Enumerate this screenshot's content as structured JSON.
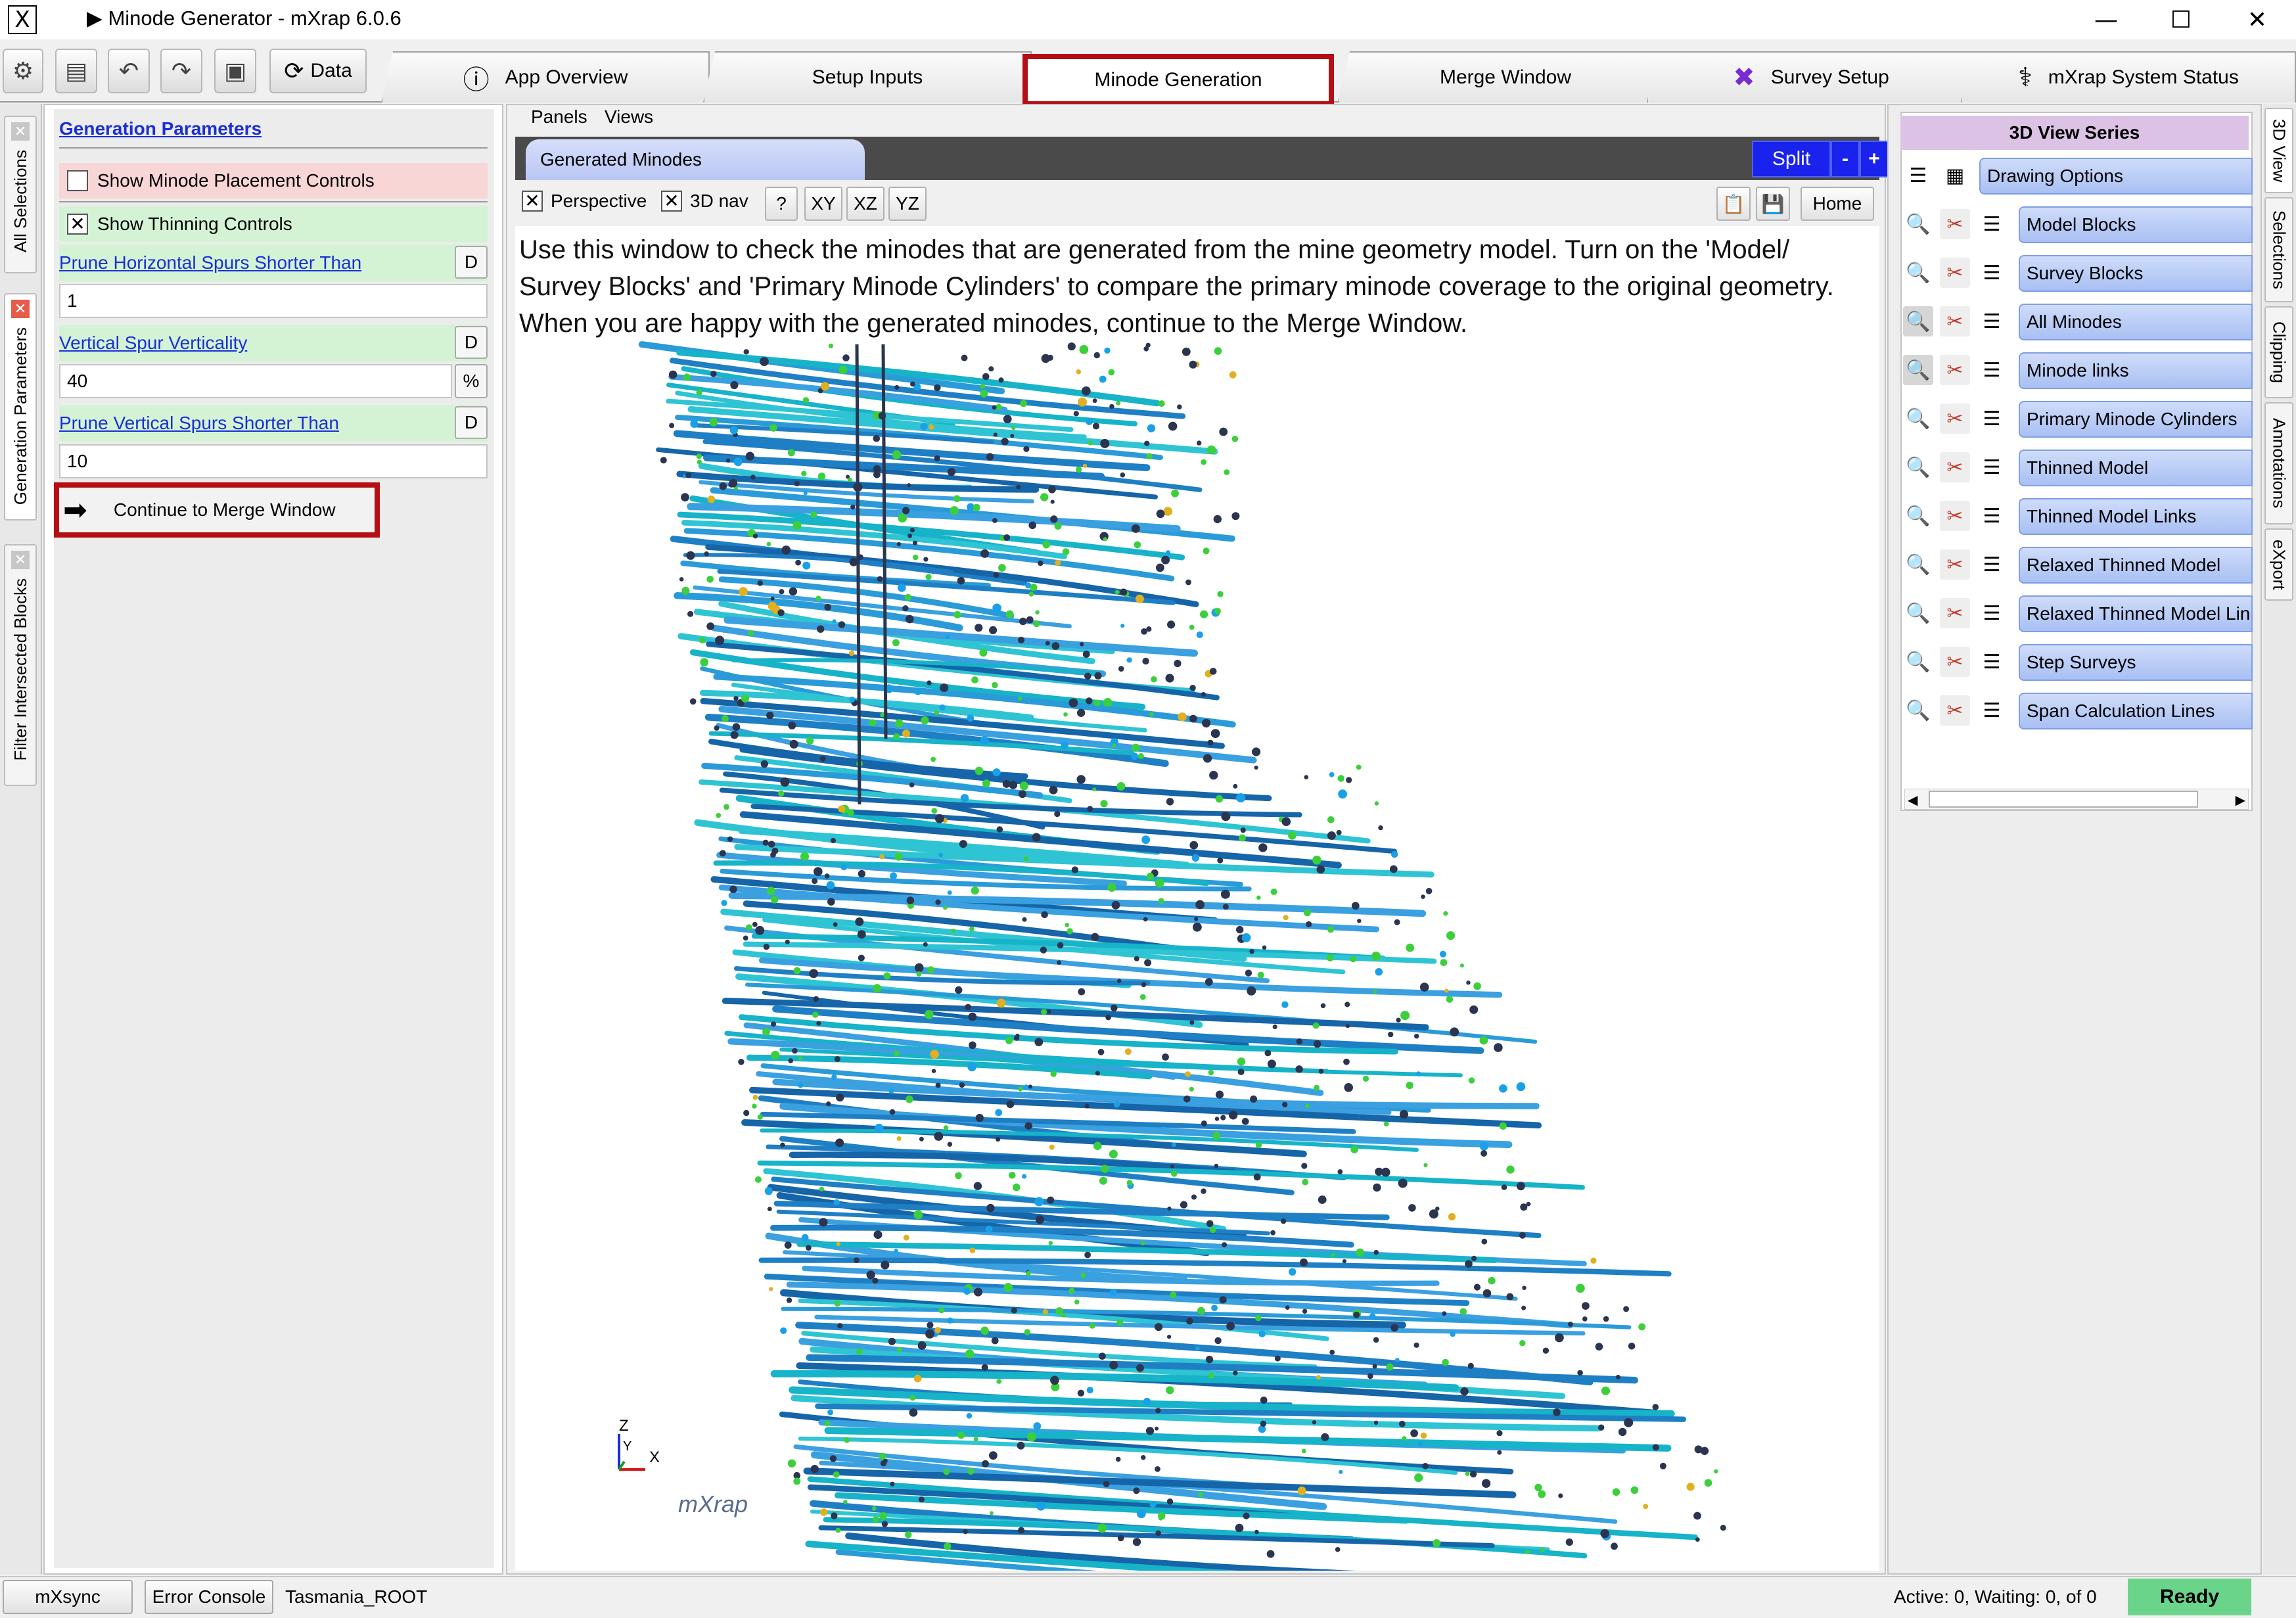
{
  "window": {
    "title": "▶ Minode Generator - mXrap 6.0.6",
    "minimize": "—",
    "maximize": "☐",
    "close": "✕"
  },
  "toolbar": {
    "data_label": "Data",
    "tabs": [
      {
        "label": "App Overview",
        "icon": "info-icon"
      },
      {
        "label": "Setup Inputs",
        "icon": ""
      },
      {
        "label": "Minode Generation",
        "icon": ""
      },
      {
        "label": "Merge Window",
        "icon": ""
      },
      {
        "label": "Survey Setup",
        "icon": "survey-icon"
      },
      {
        "label": "mXrap System Status",
        "icon": "stethoscope-icon"
      }
    ],
    "active_tab": "Minode Generation",
    "highlight_color": "#b50f15"
  },
  "left_tabs": [
    "All Selections",
    "Generation Parameters",
    "Filter Intersected Blocks"
  ],
  "left_panel": {
    "heading": "Generation Parameters",
    "placement_controls": {
      "label": "Show Minode Placement Controls",
      "checked": false
    },
    "thinning_controls": {
      "label": "Show Thinning Controls",
      "checked": true
    },
    "params": [
      {
        "label": "Prune Horizontal Spurs Shorter Than",
        "value": "1",
        "button": "D",
        "unit": ""
      },
      {
        "label": "Vertical Spur Verticality",
        "value": "40",
        "button": "D",
        "unit": "%"
      },
      {
        "label": "Prune Vertical Spurs Shorter Than",
        "value": "10",
        "button": "D",
        "unit": ""
      }
    ],
    "continue_button": "Continue to Merge Window"
  },
  "center": {
    "menu": [
      "Panels",
      "Views"
    ],
    "view_tab": "Generated Minodes",
    "split_label": "Split",
    "minus_label": "-",
    "plus_label": "+",
    "perspective": {
      "label": "Perspective",
      "checked": true
    },
    "nav3d": {
      "label": "3D nav",
      "checked": true
    },
    "help_label": "?",
    "axis_buttons": [
      "XY",
      "XZ",
      "YZ"
    ],
    "home_label": "Home",
    "info_text": "Use this window to check the minodes that are generated from the mine geometry model. Turn on the 'Model/ Survey Blocks' and 'Primary Minode Cylinders' to compare the primary minode coverage to the original geometry. When you are happy with the generated minodes, continue to the Merge Window.",
    "axis_z": "Z",
    "axis_y": "Y",
    "axis_x": "X",
    "watermark": "mXrap"
  },
  "right_panel": {
    "heading": "3D View Series",
    "drawing_options": "Drawing Options",
    "series": [
      "Model Blocks",
      "Survey Blocks",
      "All Minodes",
      "Minode links",
      "Primary Minode Cylinders",
      "Thinned Model",
      "Thinned Model Links",
      "Relaxed Thinned Model",
      "Relaxed Thinned Model Links",
      "Step Surveys",
      "Span Calculation Lines"
    ]
  },
  "right_tabs": [
    "3D View",
    "Selections",
    "Clipping",
    "Annotations",
    "eXport"
  ],
  "status": {
    "mxsync": "mXsync",
    "error_console": "Error Console",
    "root": "Tasmania_ROOT",
    "activity": "Active: 0, Waiting: 0, of 0",
    "ready": "Ready",
    "ready_color": "#6ad58a"
  }
}
